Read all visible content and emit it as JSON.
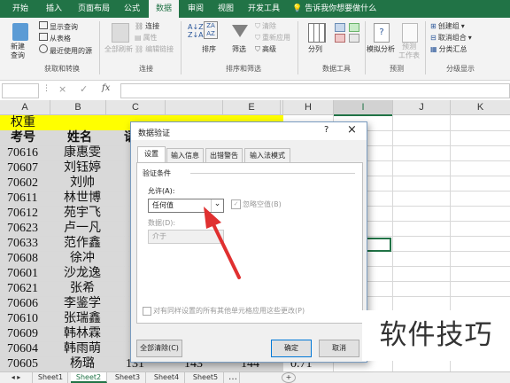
{
  "ribbon_tabs": [
    "开始",
    "插入",
    "页面布局",
    "公式",
    "数据",
    "审阅",
    "视图",
    "开发工具"
  ],
  "active_tab": "数据",
  "tell_me": "告诉我你想要做什么",
  "ribbon": {
    "get_data": {
      "new_query": "新建\n查询",
      "show_query": "显示查询",
      "from_table": "从表格",
      "recent_sources": "最近使用的源",
      "group": "获取和转换"
    },
    "connections": {
      "refresh_all": "全部刷新",
      "connections": "连接",
      "properties": "属性",
      "edit_links": "编辑链接",
      "group": "连接"
    },
    "sort_filter": {
      "sort": "排序",
      "filter": "筛选",
      "clear": "清除",
      "reapply": "重新应用",
      "advanced": "高级",
      "group": "排序和筛选"
    },
    "data_tools": {
      "split": "分列",
      "group": "数据工具"
    },
    "forecast": {
      "what_if": "模拟分析",
      "forecast_sheet": "预测\n工作表",
      "group": "预测"
    },
    "outline": {
      "create_group": "创建组",
      "ungroup": "取消组合",
      "subtotal": "分类汇总",
      "group": "分级显示"
    }
  },
  "formula_bar": {
    "cancel_icon": "×",
    "enter_icon": "✓",
    "fx": "fx"
  },
  "columns": [
    "A",
    "B",
    "C",
    "",
    "E",
    "",
    "H",
    "I",
    "J",
    "K"
  ],
  "header_row": {
    "a1": "权重"
  },
  "row2": {
    "a": "考号",
    "b": "姓名",
    "c": "语"
  },
  "rows": [
    {
      "id": "70616",
      "name": "康惠雯"
    },
    {
      "id": "70607",
      "name": "刘钰婷"
    },
    {
      "id": "70602",
      "name": "刘帅"
    },
    {
      "id": "70611",
      "name": "林世博"
    },
    {
      "id": "70612",
      "name": "苑宇飞"
    },
    {
      "id": "70623",
      "name": "卢一凡"
    },
    {
      "id": "70633",
      "name": "范作鑫"
    },
    {
      "id": "70608",
      "name": "徐冲"
    },
    {
      "id": "70601",
      "name": "沙龙逸"
    },
    {
      "id": "70621",
      "name": "张希"
    },
    {
      "id": "70606",
      "name": "李鉴学"
    },
    {
      "id": "70610",
      "name": "张瑞鑫"
    },
    {
      "id": "70609",
      "name": "韩林霖"
    },
    {
      "id": "70604",
      "name": "韩雨萌"
    },
    {
      "id": "70605",
      "name": "杨璐"
    }
  ],
  "last_row_values": {
    "c": "131",
    "d": "143",
    "e": "144",
    "f": "0.71"
  },
  "sheet_tabs": [
    "Sheet1",
    "Sheet2",
    "Sheet3",
    "Sheet4",
    "Sheet5"
  ],
  "active_sheet": "Sheet2",
  "dialog": {
    "title": "数据验证",
    "help": "?",
    "close": "×",
    "tabs": [
      "设置",
      "输入信息",
      "出错警告",
      "输入法模式"
    ],
    "section": "验证条件",
    "allow_label": "允许(A):",
    "allow_value": "任何值",
    "ignore_blank": "忽略空值(B)",
    "data_label": "数据(D):",
    "data_value": "介于",
    "apply_all": "对有同样设置的所有其他单元格应用这些更改(P)",
    "clear_all": "全部清除(C)",
    "ok": "确定",
    "cancel": "取消"
  },
  "watermark": "软件技巧",
  "colors": {
    "excel_green": "#217346",
    "yellow_row": "#ffff00",
    "gray_col": "#d9d9d9",
    "arrow_red": "#e03030"
  }
}
